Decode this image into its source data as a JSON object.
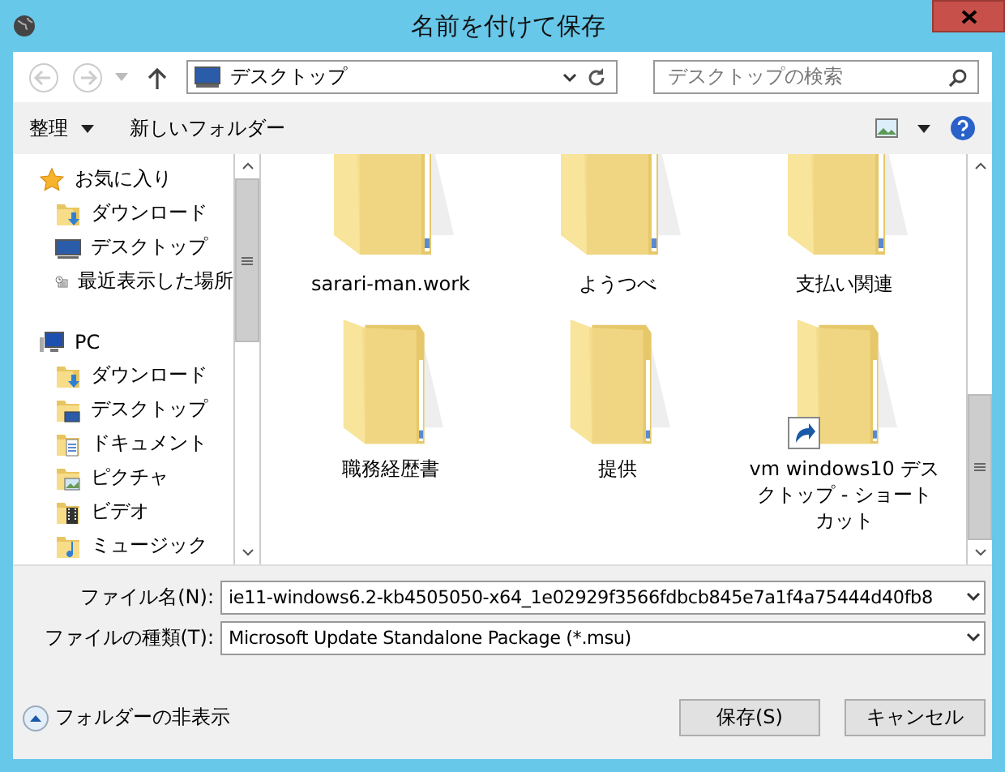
{
  "window": {
    "title": "名前を付けて保存"
  },
  "address": {
    "location": "デスクトップ",
    "search_placeholder": "デスクトップの検索"
  },
  "toolbar": {
    "organize": "整理",
    "new_folder": "新しいフォルダー"
  },
  "sidebar": {
    "items": [
      {
        "kind": "favorites",
        "label": "お気に入り",
        "children": [
          {
            "kind": "download",
            "label": "ダウンロード"
          },
          {
            "kind": "desktop",
            "label": "デスクトップ"
          },
          {
            "kind": "recent",
            "label": "最近表示した場所"
          }
        ]
      },
      {
        "kind": "pc",
        "label": "PC",
        "children": [
          {
            "kind": "download",
            "label": "ダウンロード"
          },
          {
            "kind": "desktop-folder",
            "label": "デスクトップ"
          },
          {
            "kind": "documents",
            "label": "ドキュメント"
          },
          {
            "kind": "pictures",
            "label": "ピクチャ"
          },
          {
            "kind": "videos",
            "label": "ビデオ"
          },
          {
            "kind": "music",
            "label": "ミュージック"
          }
        ]
      }
    ]
  },
  "folders": [
    {
      "name": "sarari-man.work",
      "shortcut": false
    },
    {
      "name": "ようつべ",
      "shortcut": false
    },
    {
      "name": "支払い関連",
      "shortcut": false
    },
    {
      "name": "職務経歴書",
      "shortcut": false
    },
    {
      "name": "提供",
      "shortcut": false
    },
    {
      "name": "vm windows10 デスクトップ - ショートカット",
      "shortcut": true
    }
  ],
  "file_name": {
    "label": "ファイル名(N):",
    "value": "ie11-windows6.2-kb4505050-x64_1e02929f3566fdbcb845e7a1f4a75444d40fb8"
  },
  "file_type": {
    "label": "ファイルの種類(T):",
    "value": "Microsoft Update Standalone Package (*.msu)"
  },
  "hide_folders": "フォルダーの非表示",
  "buttons": [
    "保存(S)",
    "キャンセル"
  ]
}
